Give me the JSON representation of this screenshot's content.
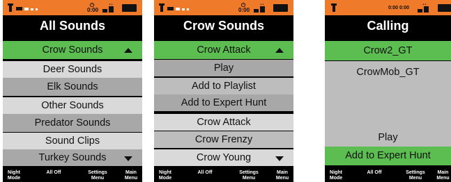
{
  "screens": [
    {
      "title": "All Sounds",
      "status": {
        "timer": "0:00"
      },
      "items": [
        {
          "label": "Crow Sounds"
        },
        {
          "label": "Deer Sounds"
        },
        {
          "label": "Elk Sounds"
        },
        {
          "label": "Other Sounds"
        },
        {
          "label": "Predator Sounds"
        },
        {
          "label": "Sound Clips"
        },
        {
          "label": "Turkey Sounds"
        }
      ]
    },
    {
      "title": "Crow Sounds",
      "status": {
        "timer": "0:00"
      },
      "items": [
        {
          "label": "Crow Attack"
        },
        {
          "label": "Play"
        },
        {
          "label": "Add to Playlist"
        },
        {
          "label": "Add to Expert Hunt"
        },
        {
          "label": "Crow Attack"
        },
        {
          "label": "Crow Frenzy"
        },
        {
          "label": "Crow Young"
        }
      ]
    },
    {
      "title": "Calling",
      "status": {
        "timer1": "0:00",
        "timer2": "0:00"
      },
      "items": [
        {
          "label": "Crow2_GT"
        },
        {
          "label": "CrowMob_GT"
        },
        {
          "label": "Play"
        },
        {
          "label": "Add to Expert Hunt"
        }
      ]
    }
  ],
  "footer": {
    "night_mode": "Night Mode",
    "all_off": "All Off",
    "settings_menu": "Settings Menu",
    "main_menu": "Main Menu"
  },
  "colors": {
    "status_orange": "#ef7a2a",
    "highlight_green": "#5cbd50",
    "row_light": "#d9d9d9",
    "row_mid": "#bdbdbd",
    "row_dark": "#a8a8a8",
    "footer_black": "#000000"
  },
  "icons": [
    "speaker-icon",
    "volume-icon",
    "timer-icon",
    "signal-icon",
    "battery-icon",
    "up-arrow-icon",
    "down-arrow-icon"
  ]
}
